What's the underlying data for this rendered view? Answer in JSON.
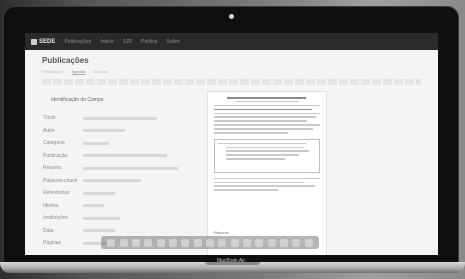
{
  "device": {
    "brand_label": "MacBook Air"
  },
  "topbar": {
    "logo": "SEDE",
    "nav": [
      "Publicações",
      "Índice",
      "SJR",
      "Política",
      "Sobre"
    ]
  },
  "page": {
    "title": "Publicações",
    "tabs": [
      "Publicações",
      "Agenda",
      "Notícias"
    ],
    "metadata_heading": "Identificação do Campo",
    "metadata_labels": [
      "Título",
      "Autor",
      "Categoria",
      "Publicação",
      "Resumo",
      "Palavras-chave",
      "Referências",
      "Idioma",
      "Instituições",
      "Data",
      "Páginas"
    ],
    "metadata_value_widths": [
      0.7,
      0.4,
      0.25,
      0.8,
      0.9,
      0.55,
      0.3,
      0.2,
      0.35,
      0.3,
      0.25
    ],
    "preview_caption": "Resumo"
  },
  "dock": {
    "icons": [
      "finder-icon",
      "launchpad-icon",
      "safari-icon",
      "mail-icon",
      "contacts-icon",
      "calendar-icon",
      "notes-icon",
      "reminders-icon",
      "maps-icon",
      "photos-icon",
      "messages-icon",
      "facetime-icon",
      "itunes-icon",
      "ibooks-icon",
      "appstore-icon",
      "preferences-icon",
      "trash-icon"
    ]
  }
}
